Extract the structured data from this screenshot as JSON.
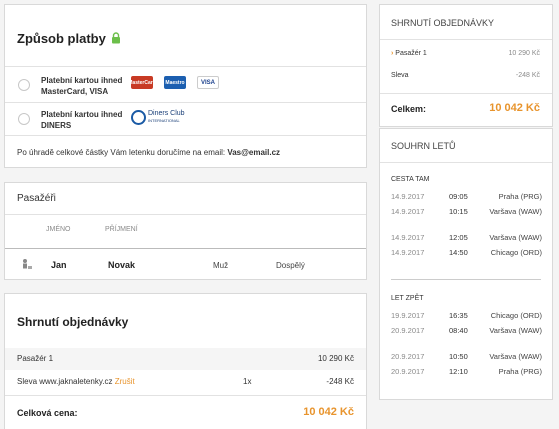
{
  "payment": {
    "title": "Způsob platby",
    "options": [
      {
        "line1": "Platební kartou ihned",
        "line2": "MasterCard, VISA",
        "logos": [
          "MasterCard",
          "Maestro",
          "VISA"
        ]
      },
      {
        "line1": "Platební kartou ihned",
        "line2": "DINERS",
        "logos": [
          "Diners Club",
          "INTERNATIONAL"
        ]
      }
    ],
    "note_prefix": "Po úhradě celkové částky Vám letenku doručíme na email: ",
    "email": "Vas@email.cz"
  },
  "passengers": {
    "title": "Pasažéři",
    "col_first": "JMÉNO",
    "col_last": "PŘÍJMENÍ",
    "row": {
      "first": "Jan",
      "last": "Novak",
      "gender": "Muž",
      "type": "Dospělý"
    }
  },
  "order": {
    "title": "Shrnutí objednávky",
    "passenger_label": "Pasažér 1",
    "passenger_price": "10 290 Kč",
    "discount_label": "Sleva www.jaknaletenky.cz",
    "discount_cancel": "Zrušit",
    "discount_qty": "1x",
    "discount_price": "-248 Kč",
    "total_label": "Celková cena:",
    "total_price": "10 042 Kč"
  },
  "sidebar_order": {
    "title": "SHRNUTÍ OBJEDNÁVKY",
    "passenger_label": "Pasažér 1",
    "passenger_price": "10 290 Kč",
    "discount_label": "Sleva",
    "discount_price": "-248 Kč",
    "total_label": "Celkem:",
    "total_price": "10 042 Kč"
  },
  "flights": {
    "title": "SOUHRN LETŮ",
    "outbound": {
      "label": "CESTA TAM",
      "legs": [
        {
          "date": "14.9.2017",
          "time": "09:05",
          "place": "Praha (PRG)"
        },
        {
          "date": "14.9.2017",
          "time": "10:15",
          "place": "Varšava (WAW)"
        },
        {
          "date": "14.9.2017",
          "time": "12:05",
          "place": "Varšava (WAW)"
        },
        {
          "date": "14.9.2017",
          "time": "14:50",
          "place": "Chicago (ORD)"
        }
      ]
    },
    "return": {
      "label": "LET ZPĚT",
      "legs": [
        {
          "date": "19.9.2017",
          "time": "16:35",
          "place": "Chicago (ORD)"
        },
        {
          "date": "20.9.2017",
          "time": "08:40",
          "place": "Varšava (WAW)"
        },
        {
          "date": "20.9.2017",
          "time": "10:50",
          "place": "Varšava (WAW)"
        },
        {
          "date": "20.9.2017",
          "time": "12:10",
          "place": "Praha (PRG)"
        }
      ]
    }
  },
  "colors": {
    "accent": "#e8942d",
    "lock": "#6cbf4a",
    "border": "#d9d9d9"
  }
}
